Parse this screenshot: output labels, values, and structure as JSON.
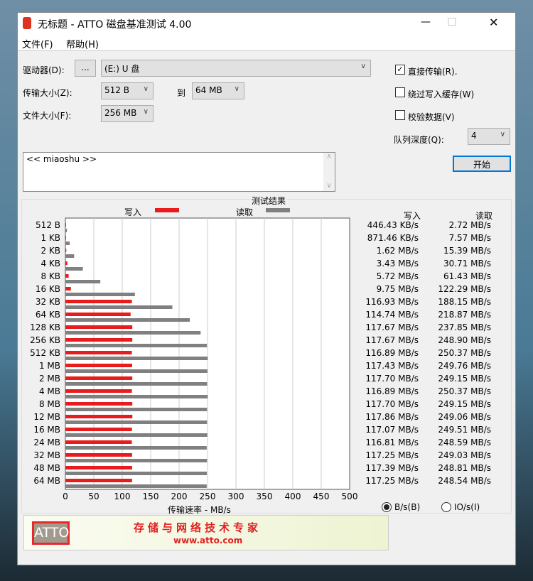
{
  "window": {
    "title": "无标题 - ATTO 磁盘基准测试 4.00",
    "minimize": "—",
    "maximize": "☐",
    "close": "✕"
  },
  "menu": {
    "file": "文件(F)",
    "help": "帮助(H)"
  },
  "form": {
    "drive_label": "驱动器(D):",
    "browse_button": "...",
    "drive_value": "(E:) U 盘",
    "transfer_label": "传输大小(Z):",
    "transfer_from": "512 B",
    "to_label": "到",
    "transfer_to": "64 MB",
    "file_size_label": "文件大小(F):",
    "file_size": "256 MB",
    "direct_io": {
      "label": "直接传输(R).",
      "checked": true
    },
    "bypass_cache": {
      "label": "绕过写入缓存(W)",
      "checked": false
    },
    "verify": {
      "label": "校验数据(V)",
      "checked": false
    },
    "queue_label": "队列深度(Q):",
    "queue_value": "4",
    "start_button": "开始",
    "description": "<< miaoshu >>"
  },
  "results": {
    "title": "测试结果",
    "write_header": "写入",
    "read_header": "读取",
    "write_values": [
      "446.43 KB/s",
      "871.46 KB/s",
      "1.62 MB/s",
      "3.43 MB/s",
      "5.72 MB/s",
      "9.75 MB/s",
      "116.93 MB/s",
      "114.74 MB/s",
      "117.67 MB/s",
      "117.67 MB/s",
      "116.89 MB/s",
      "117.43 MB/s",
      "117.70 MB/s",
      "116.89 MB/s",
      "117.70 MB/s",
      "117.86 MB/s",
      "117.07 MB/s",
      "116.81 MB/s",
      "117.25 MB/s",
      "117.39 MB/s",
      "117.25 MB/s"
    ],
    "read_values": [
      "2.72 MB/s",
      "7.57 MB/s",
      "15.39 MB/s",
      "30.71 MB/s",
      "61.43 MB/s",
      "122.29 MB/s",
      "188.15 MB/s",
      "218.87 MB/s",
      "237.85 MB/s",
      "248.90 MB/s",
      "250.37 MB/s",
      "249.76 MB/s",
      "249.15 MB/s",
      "250.37 MB/s",
      "249.15 MB/s",
      "249.06 MB/s",
      "249.51 MB/s",
      "248.59 MB/s",
      "249.03 MB/s",
      "248.81 MB/s",
      "248.54 MB/s"
    ],
    "units_bytes": "B/s(B)",
    "units_io": "IO/s(I)",
    "units_selected": "bytes"
  },
  "chart_data": {
    "type": "bar",
    "orientation": "horizontal",
    "legend": [
      {
        "name": "写入",
        "color": "#e81c1c"
      },
      {
        "name": "读取",
        "color": "#808080"
      }
    ],
    "legend_placement": "top",
    "categories": [
      "512 B",
      "1 KB",
      "2 KB",
      "4 KB",
      "8 KB",
      "16 KB",
      "32 KB",
      "64 KB",
      "128 KB",
      "256 KB",
      "512 KB",
      "1 MB",
      "2 MB",
      "4 MB",
      "8 MB",
      "12 MB",
      "16 MB",
      "24 MB",
      "32 MB",
      "48 MB",
      "64 MB"
    ],
    "series": [
      {
        "name": "写入",
        "values": [
          0.436,
          0.851,
          1.62,
          3.43,
          5.72,
          9.75,
          116.93,
          114.74,
          117.67,
          117.67,
          116.89,
          117.43,
          117.7,
          116.89,
          117.7,
          117.86,
          117.07,
          116.81,
          117.25,
          117.39,
          117.25
        ]
      },
      {
        "name": "读取",
        "values": [
          2.72,
          7.57,
          15.39,
          30.71,
          61.43,
          122.29,
          188.15,
          218.87,
          237.85,
          248.9,
          250.37,
          249.76,
          249.15,
          250.37,
          249.15,
          249.06,
          249.51,
          248.59,
          249.03,
          248.81,
          248.54
        ]
      }
    ],
    "xlabel": "传输速率 - MB/s",
    "xlim": [
      0,
      500
    ],
    "xticks": [
      "0",
      "50",
      "100",
      "150",
      "200",
      "250",
      "300",
      "350",
      "400",
      "450",
      "500"
    ],
    "grid": true
  },
  "banner": {
    "logo": "ATTO",
    "slogan": "存储与网络技术专家",
    "url": "www.atto.com"
  }
}
